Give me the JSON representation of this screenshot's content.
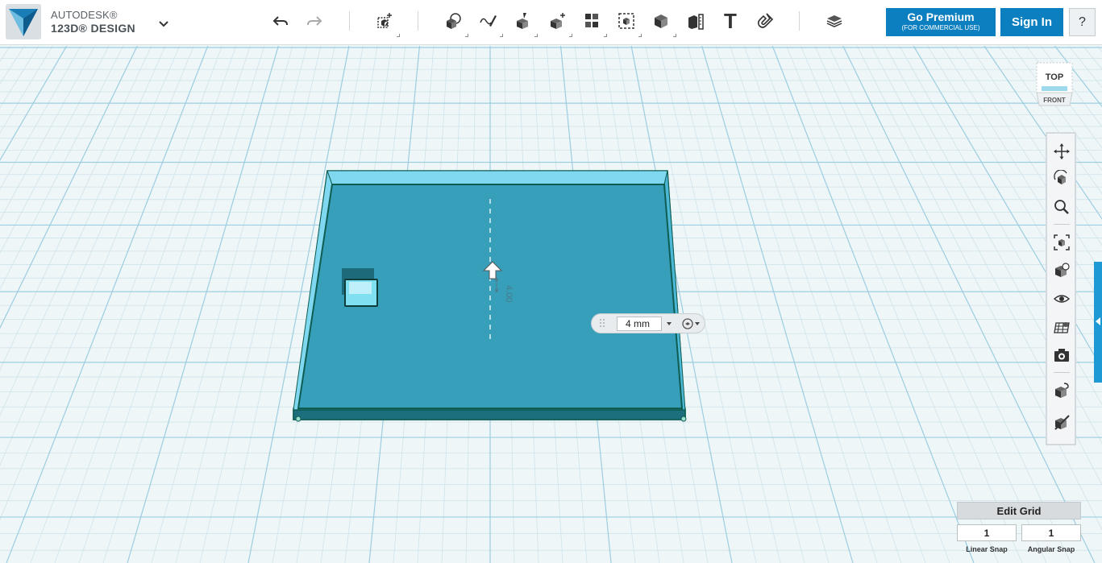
{
  "brand": {
    "line1": "AUTODESK®",
    "line2": "123D® DESIGN"
  },
  "toolbar": {
    "buttons": [
      {
        "name": "undo-button",
        "icon": "undo-icon"
      },
      {
        "name": "redo-button",
        "icon": "redo-icon"
      },
      {
        "name": "transform-button",
        "icon": "transform-icon"
      },
      {
        "name": "primitives-button",
        "icon": "primitives-icon"
      },
      {
        "name": "sketch-button",
        "icon": "sketch-icon"
      },
      {
        "name": "construct-button",
        "icon": "construct-icon"
      },
      {
        "name": "modify-button",
        "icon": "modify-icon"
      },
      {
        "name": "pattern-button",
        "icon": "pattern-icon"
      },
      {
        "name": "grouping-button",
        "icon": "grouping-icon"
      },
      {
        "name": "combine-button",
        "icon": "combine-icon"
      },
      {
        "name": "measure-button",
        "icon": "measure-icon"
      },
      {
        "name": "text-button",
        "icon": "text-icon"
      },
      {
        "name": "snap-button",
        "icon": "snap-magnet-icon"
      },
      {
        "name": "material-button",
        "icon": "material-layers-icon"
      }
    ],
    "text_tool_glyph": "T"
  },
  "actions": {
    "go_premium": "Go Premium",
    "go_premium_sub": "(FOR COMMERCIAL USE)",
    "sign_in": "Sign In",
    "help": "?"
  },
  "view_cube": {
    "top": "TOP",
    "front": "FRONT"
  },
  "navbar": {
    "items": [
      "pan-icon",
      "orbit-icon",
      "zoom-icon",
      "fit-icon",
      "views-icon",
      "visibility-icon",
      "grid-icon",
      "screenshot-icon",
      "material-icon",
      "outline-icon"
    ]
  },
  "dimension": {
    "value": "4 mm",
    "ghost_label": "4.00"
  },
  "grid": {
    "edit_label": "Edit Grid",
    "linear_value": "1",
    "angular_value": "1",
    "linear_label": "Linear Snap",
    "angular_label": "Angular Snap"
  },
  "colors": {
    "accent": "#0b7fbf",
    "grid_minor": "#cfe3ea",
    "grid_major": "#9dcde0",
    "solid_top": "#3a9fb9",
    "solid_edge": "#7fd8f0",
    "solid_outline": "#0f5c52"
  }
}
